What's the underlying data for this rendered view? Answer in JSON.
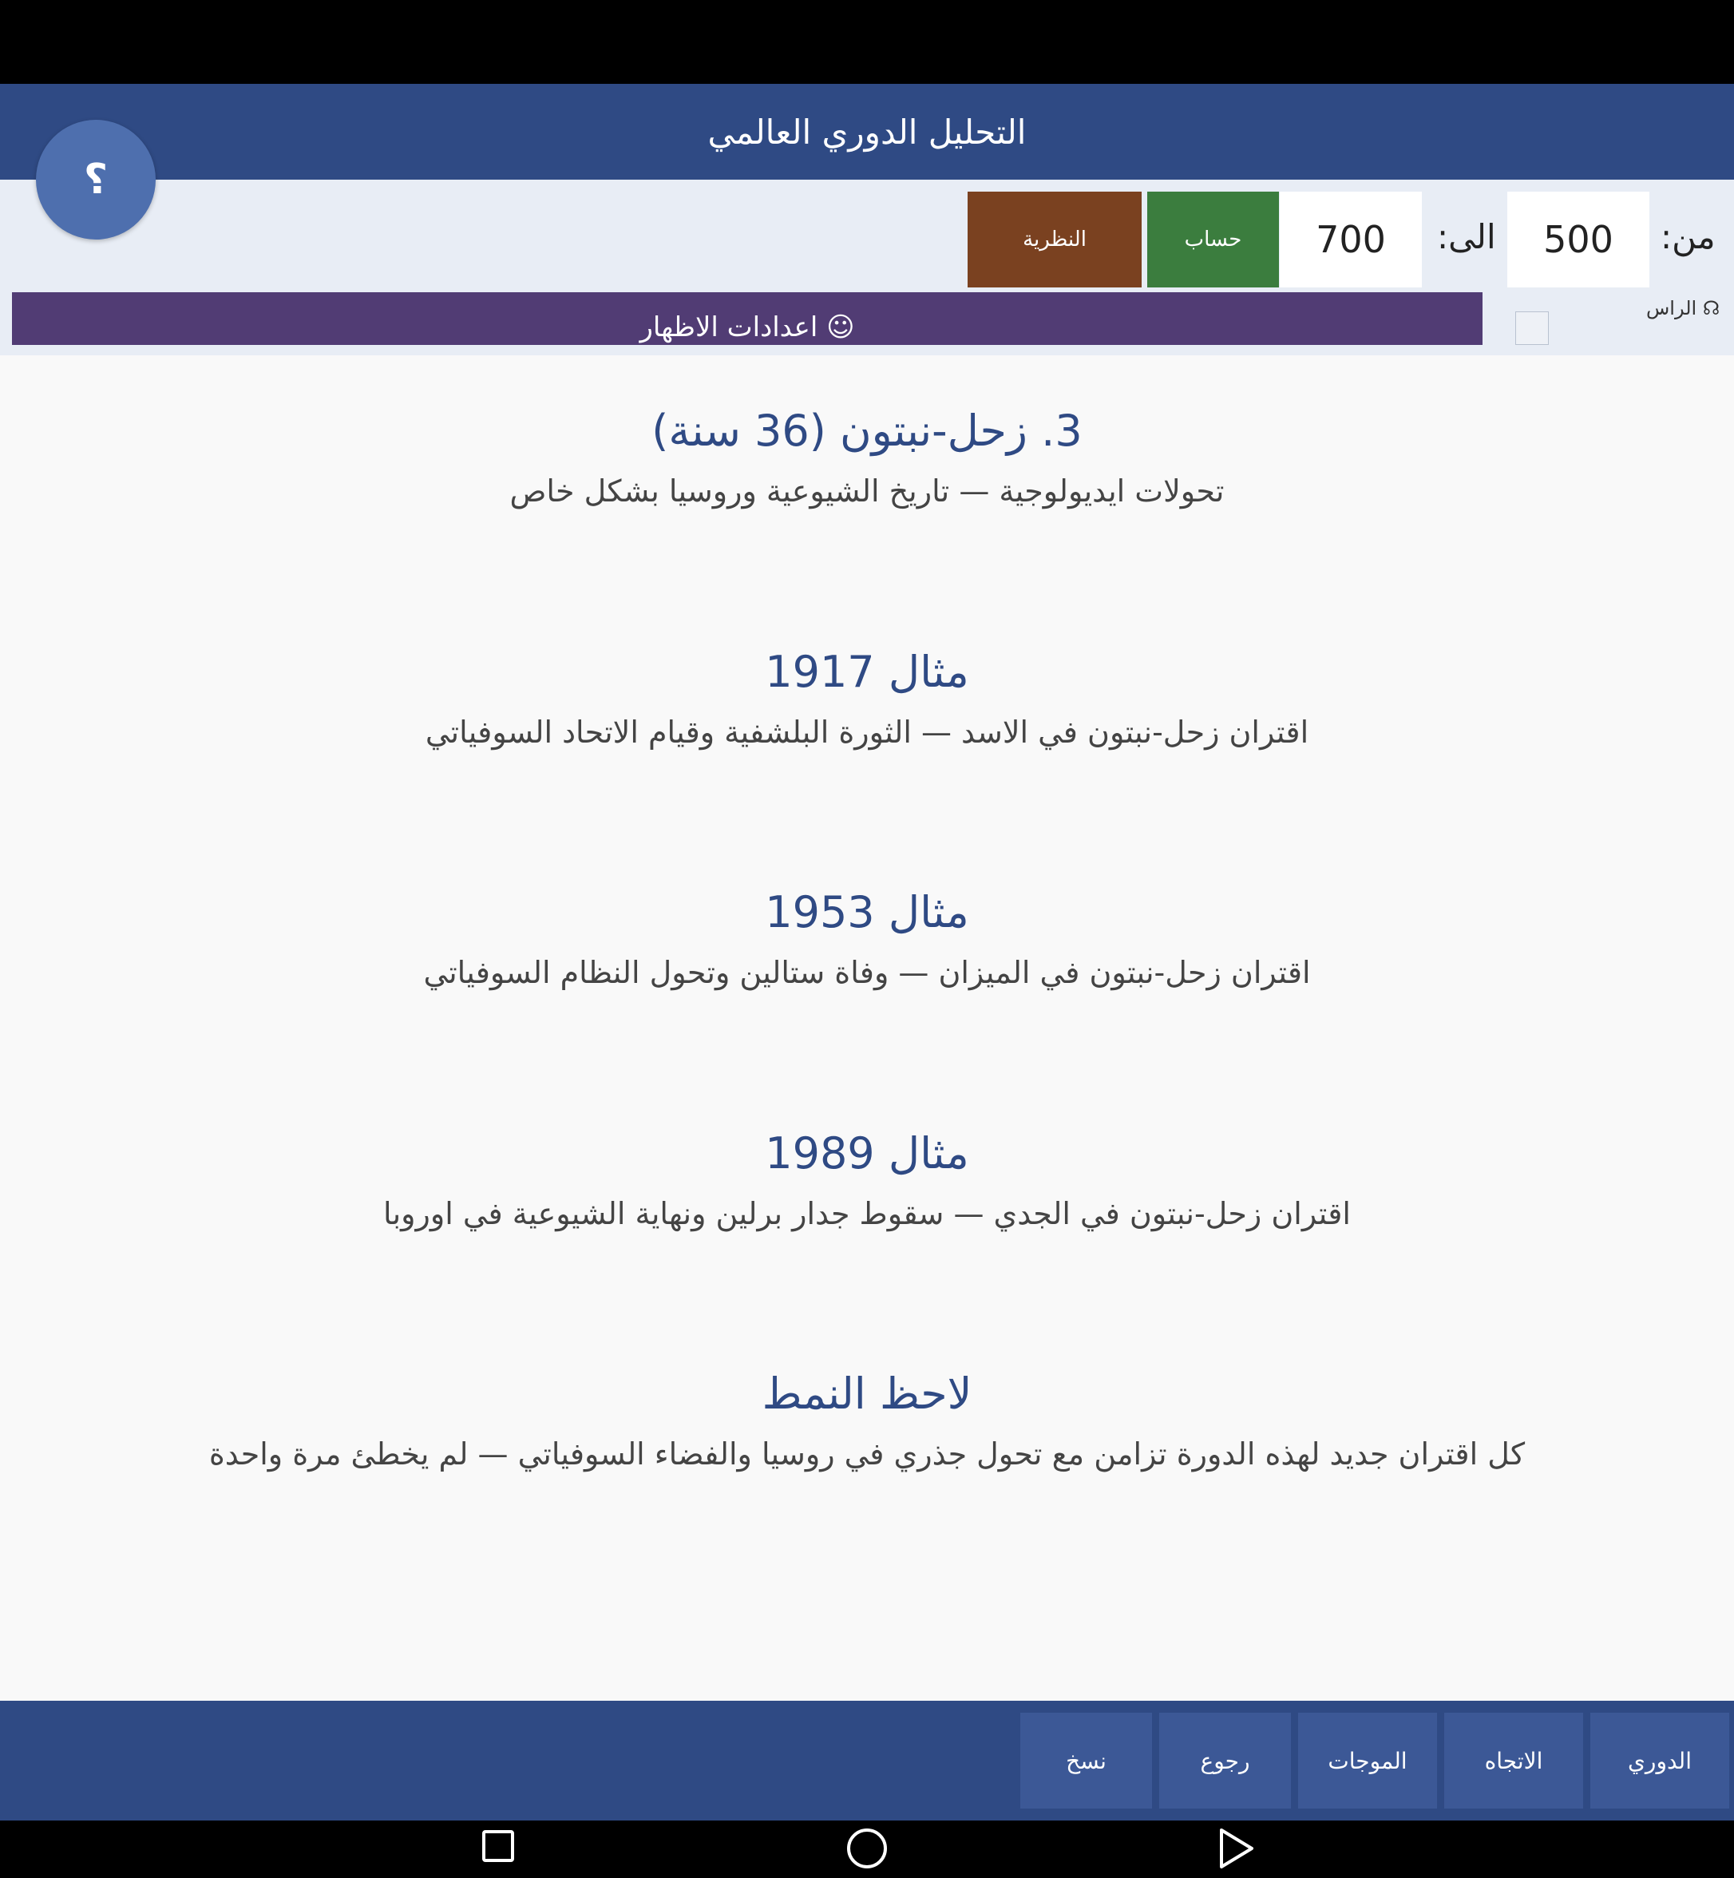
{
  "header": {
    "title": "التحليل الدوري العالمي"
  },
  "help": {
    "label": "؟"
  },
  "toolbar": {
    "from_label": "من:",
    "from_value": "500",
    "to_label": "الى:",
    "to_value": "700",
    "calc_label": "حساب",
    "theory_label": "النظرية",
    "banner_text": "☺ اعدادات الاظهار",
    "head_label": "☊ الراس"
  },
  "sections": [
    {
      "title": "3. زحل-نبتون (36 سنة)",
      "desc": "تحولات ايديولوجية — تاريخ الشيوعية وروسيا بشكل خاص"
    },
    {
      "title": "مثال 1917",
      "desc": "اقتران زحل-نبتون في الاسد — الثورة البلشفية وقيام الاتحاد السوفياتي"
    },
    {
      "title": "مثال 1953",
      "desc": "اقتران زحل-نبتون في الميزان — وفاة ستالين وتحول النظام السوفياتي"
    },
    {
      "title": "مثال 1989",
      "desc": "اقتران زحل-نبتون في الجدي — سقوط جدار برلين ونهاية الشيوعية في اوروبا"
    },
    {
      "title": "لاحظ النمط",
      "desc": "كل اقتران جديد لهذه الدورة تزامن مع تحول جذري في روسيا والفضاء السوفياتي — لم يخطئ مرة واحدة"
    }
  ],
  "bottom_nav": {
    "cyclic": "الدوري",
    "direction": "الاتجاه",
    "waves": "الموجات",
    "back": "رجوع",
    "copy": "نسخ"
  },
  "colors": {
    "header_bg": "#2f4a84",
    "calc_bg": "#3b7d3e",
    "theory_bg": "#7a4120",
    "banner_bg": "#513c74",
    "help_bg": "#4e6fae"
  }
}
